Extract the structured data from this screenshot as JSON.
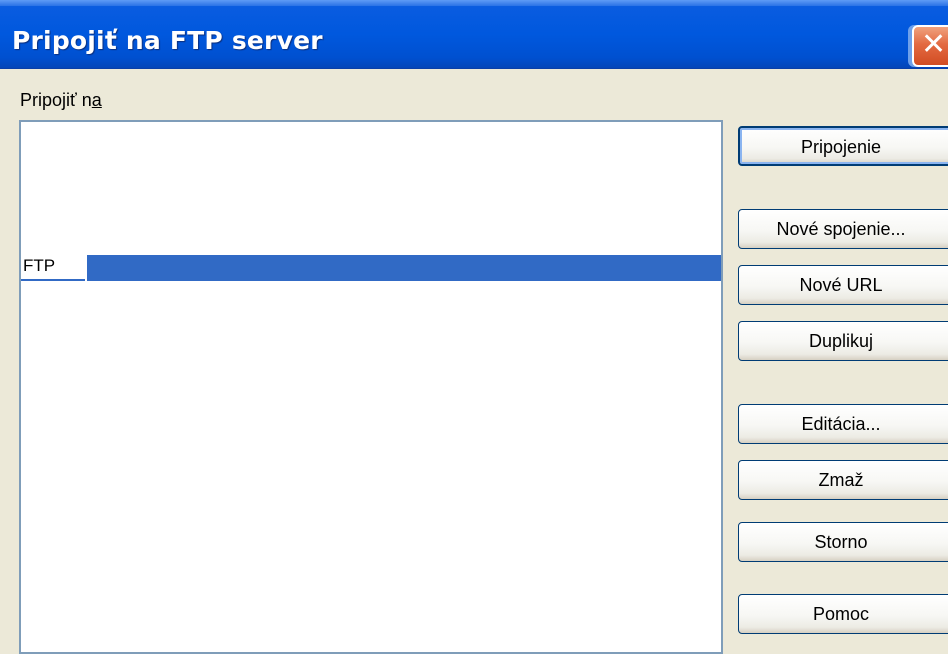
{
  "window": {
    "title": "Pripojiť na FTP server",
    "close_glyph": "✕"
  },
  "main": {
    "connect_to_label_prefix": "Pripojiť n",
    "connect_to_label_mnemonic": "a",
    "list": {
      "items": [
        {
          "label": "FTP",
          "selected": true
        }
      ]
    }
  },
  "buttons": {
    "connect": "Pripojenie",
    "new_connection": "Nové spojenie...",
    "new_url": "Nové URL",
    "duplicate": "Duplikuj",
    "edit": "Editácia...",
    "delete": "Zmaž",
    "cancel": "Storno",
    "help": "Pomoc"
  },
  "colors": {
    "titlebar": "#0058de",
    "selection": "#316ac5",
    "face": "#ece9d8",
    "list_border": "#7f9db9"
  },
  "icons": {
    "close": "close-icon"
  }
}
